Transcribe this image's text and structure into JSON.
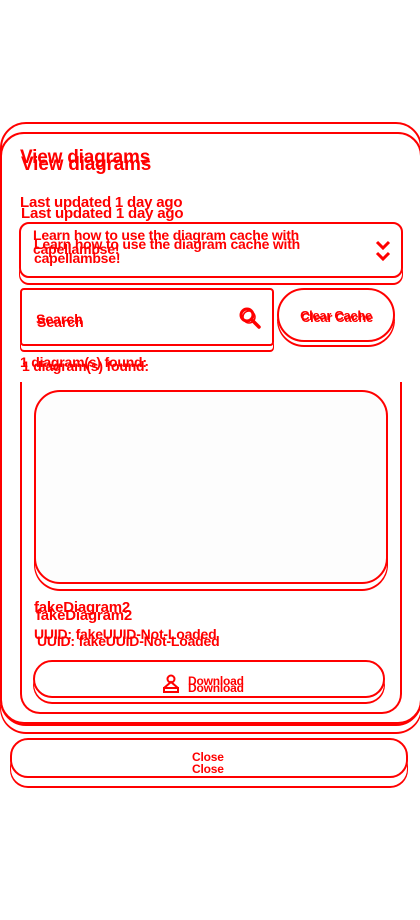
{
  "dialog": {
    "title": "View diagrams",
    "last_updated": "Last updated 1 day ago",
    "info_dropdown_text": "Learn how to use the diagram cache with capellambse!",
    "info_dropdown_icon": "chevron-down-icon"
  },
  "search": {
    "placeholder": "Search",
    "icon": "search-icon"
  },
  "clear_cache": {
    "label": "Clear Cache"
  },
  "results": {
    "count_text": "1 diagram(s) found:"
  },
  "diagram_card": {
    "name": "fakeDiagram2",
    "uuid": "UUID: fakeUUID-Not-Loaded",
    "download_label": "Download",
    "download_icon": "download-icon"
  },
  "footer": {
    "close_label": "Close"
  },
  "colors": {
    "accent": "#ff0000",
    "background": "#ffffff"
  }
}
